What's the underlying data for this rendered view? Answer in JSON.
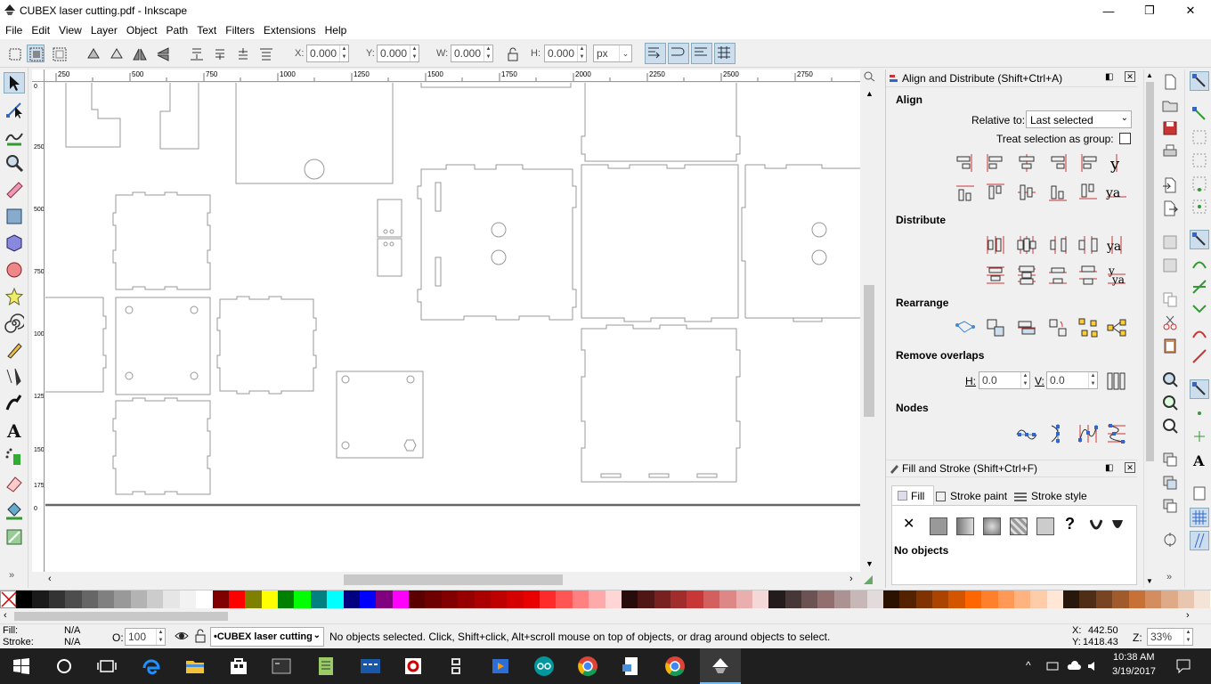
{
  "window": {
    "title": "CUBEX laser cutting.pdf - Inkscape",
    "minimize": "—",
    "maximize": "❐",
    "close": "✕"
  },
  "menu": [
    "File",
    "Edit",
    "View",
    "Layer",
    "Object",
    "Path",
    "Text",
    "Filters",
    "Extensions",
    "Help"
  ],
  "toolbar": {
    "x_label": "X:",
    "x_value": "0.000",
    "y_label": "Y:",
    "y_value": "0.000",
    "w_label": "W:",
    "w_value": "0.000",
    "h_label": "H:",
    "h_value": "0.000",
    "unit": "px"
  },
  "ruler": {
    "top_labels": [
      "250",
      "500",
      "750",
      "1000",
      "1250",
      "1500",
      "1750",
      "2000",
      "2250",
      "2500",
      "2750"
    ],
    "left_labels": [
      "0",
      "250",
      "500",
      "750",
      "1000",
      "1250",
      "1500",
      "1750",
      "0"
    ]
  },
  "align_panel": {
    "title": "Align and Distribute (Shift+Ctrl+A)",
    "align_heading": "Align",
    "relative_to_label": "Relative to:",
    "relative_to_value": "Last selected",
    "treat_group_label": "Treat selection as group:",
    "distribute_heading": "Distribute",
    "rearrange_heading": "Rearrange",
    "remove_overlaps_heading": "Remove overlaps",
    "h_label": "H:",
    "h_value": "0.0",
    "v_label": "V:",
    "v_value": "0.0",
    "nodes_heading": "Nodes",
    "align_icon_text": "y",
    "align_icon_text2": "ya"
  },
  "fill_panel": {
    "title": "Fill and Stroke (Shift+Ctrl+F)",
    "tabs": [
      "Fill",
      "Stroke paint",
      "Stroke style"
    ],
    "no_objects": "No objects",
    "unknown_icon": "?"
  },
  "palette_colors": [
    "#000000",
    "#1a1a1a",
    "#333333",
    "#4d4d4d",
    "#666666",
    "#808080",
    "#999999",
    "#b3b3b3",
    "#cccccc",
    "#e6e6e6",
    "#f2f2f2",
    "#ffffff",
    "#800000",
    "#ff0000",
    "#808000",
    "#ffff00",
    "#008000",
    "#00ff00",
    "#008080",
    "#00ffff",
    "#000080",
    "#0000ff",
    "#800080",
    "#ff00ff",
    "#5a0000",
    "#6e0000",
    "#820000",
    "#960000",
    "#aa0000",
    "#be0000",
    "#d40000",
    "#e80000",
    "#ff2a2a",
    "#ff5555",
    "#ff8080",
    "#ffaaaa",
    "#ffd5d5",
    "#280b0b",
    "#501616",
    "#782121",
    "#a02c2c",
    "#c83737",
    "#d35f5f",
    "#de8787",
    "#e9afaf",
    "#f4d7d7",
    "#241c1c",
    "#483737",
    "#6c5353",
    "#916f6f",
    "#ac9393",
    "#c8b7b7",
    "#e3dbdb",
    "#2b1100",
    "#552200",
    "#803300",
    "#aa4400",
    "#d45500",
    "#ff6600",
    "#ff7f2a",
    "#ff9955",
    "#ffb380",
    "#ffccaa",
    "#ffe6d5",
    "#28170b",
    "#502d16",
    "#784421",
    "#a05a2c",
    "#c87137",
    "#d38d5f",
    "#deaa87",
    "#e9c6af",
    "#f4e3d7"
  ],
  "status": {
    "fill_label": "Fill:",
    "fill_value": "N/A",
    "stroke_label": "Stroke:",
    "stroke_value": "N/A",
    "opacity_label": "O:",
    "opacity_value": "100",
    "layer": "•CUBEX laser cutting",
    "message": "No objects selected. Click, Shift+click, Alt+scroll mouse on top of objects, or drag around objects to select.",
    "x_label": "X:",
    "x_value": "442.50",
    "y_label": "Y:",
    "y_value": "1418.43",
    "z_label": "Z:",
    "zoom": "33%"
  },
  "taskbar": {
    "time": "10:38 AM",
    "date": "3/19/2017"
  },
  "colors": {
    "accent": "#0078d7",
    "outline": "#999999",
    "taskbar": "#1f1f1f"
  }
}
